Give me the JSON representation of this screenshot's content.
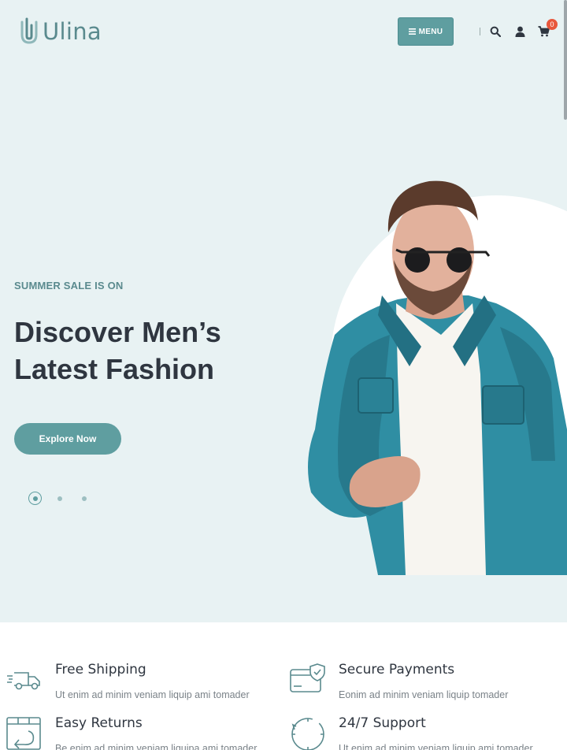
{
  "header": {
    "logo_text": "Ulina",
    "menu_label": "MENU",
    "cart_count": "0",
    "icons": [
      "search-icon",
      "user-icon",
      "cart-icon",
      "hamburger-icon"
    ]
  },
  "hero": {
    "eyebrow": "SUMMER SALE IS ON",
    "title_line1": "Discover Men’s",
    "title_line2": "Latest Fashion",
    "cta_label": "Explore Now",
    "slides_count": 3,
    "active_slide": 1
  },
  "features": [
    {
      "icon": "truck-icon",
      "title": "Free Shipping",
      "desc": "Ut enim ad minim veniam liquip ami tomader"
    },
    {
      "icon": "secure-card-icon",
      "title": "Secure Payments",
      "desc": "Eonim ad minim veniam liquip tomader"
    },
    {
      "icon": "return-box-icon",
      "title": "Easy Returns",
      "desc": "Be enim ad minim veniam liquipa ami tomader"
    },
    {
      "icon": "support-24-icon",
      "title": "24/7 Support",
      "desc": "Ut enim ad minim veniam liquip ami tomader"
    }
  ],
  "colors": {
    "accent": "#5f9ea0",
    "hero_bg": "#e8f2f3",
    "heading": "#2f3640",
    "badge": "#e8573c"
  }
}
